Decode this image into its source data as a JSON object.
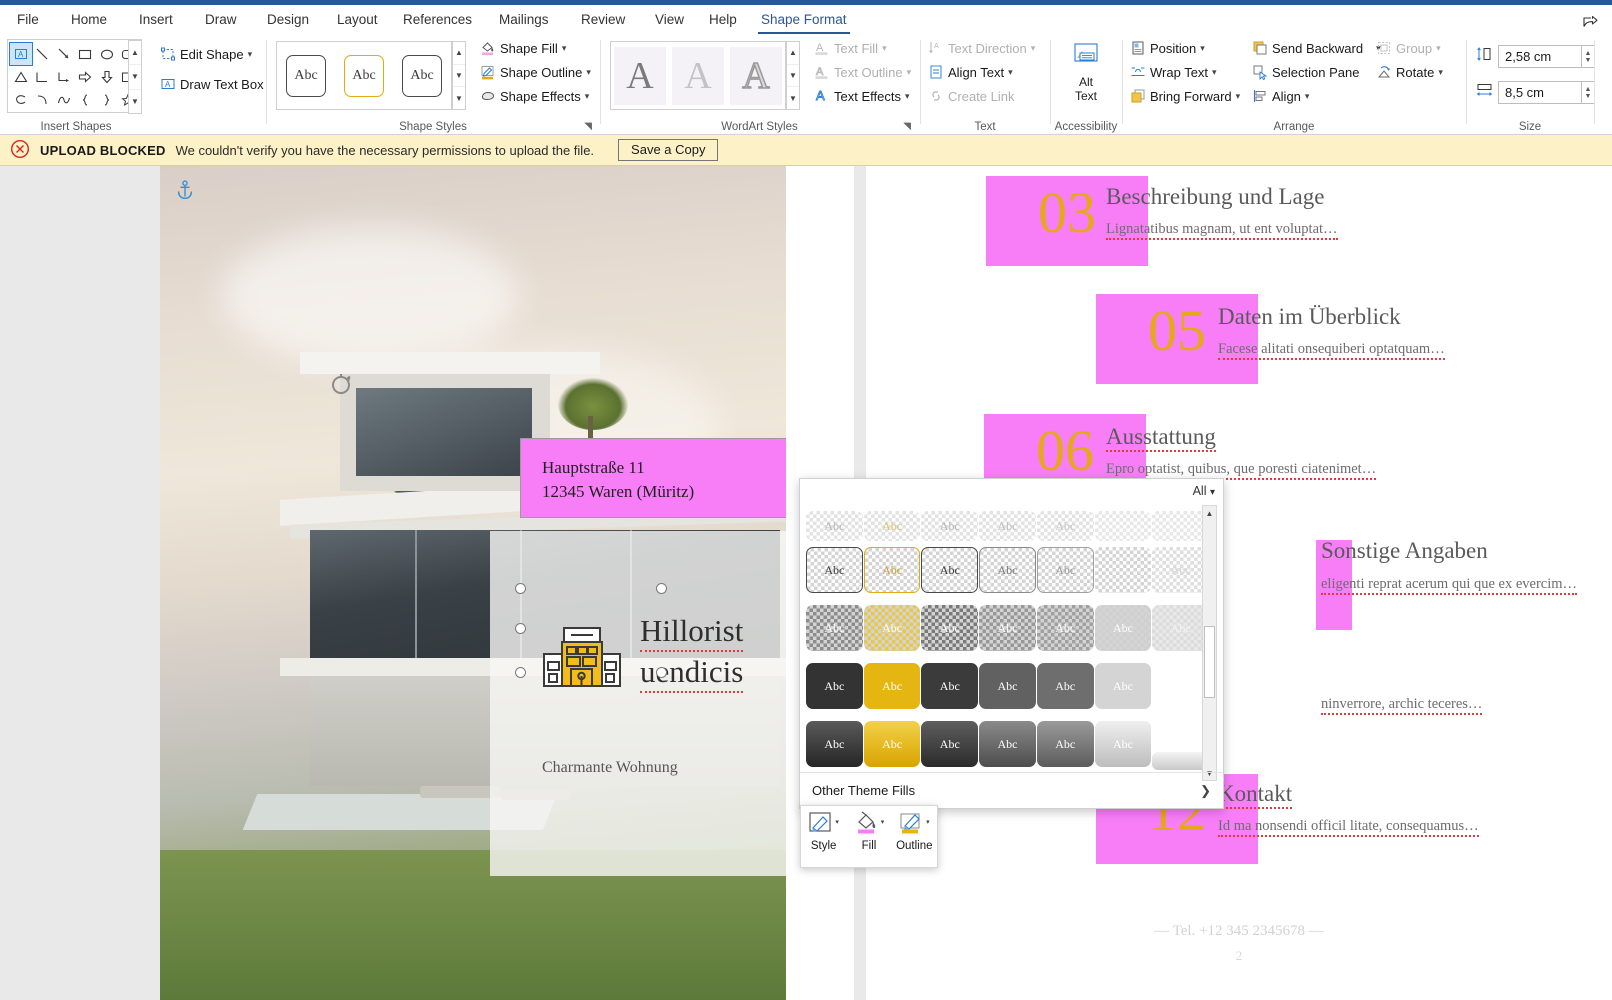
{
  "app": {
    "accent_blue": "#2b579a",
    "share_icon": "share-icon"
  },
  "tabs": [
    {
      "label": "File",
      "active": false
    },
    {
      "label": "Home",
      "active": false
    },
    {
      "label": "Insert",
      "active": false
    },
    {
      "label": "Draw",
      "active": false
    },
    {
      "label": "Design",
      "active": false
    },
    {
      "label": "Layout",
      "active": false
    },
    {
      "label": "References",
      "active": false
    },
    {
      "label": "Mailings",
      "active": false
    },
    {
      "label": "Review",
      "active": false
    },
    {
      "label": "View",
      "active": false
    },
    {
      "label": "Help",
      "active": false
    },
    {
      "label": "Shape Format",
      "active": true
    }
  ],
  "ribbon": {
    "groups": [
      {
        "name": "Insert Shapes",
        "label": "Insert Shapes"
      },
      {
        "name": "Shape Styles",
        "label": "Shape Styles"
      },
      {
        "name": "WordArt Styles",
        "label": "WordArt Styles"
      },
      {
        "name": "Text",
        "label": "Text"
      },
      {
        "name": "Accessibility",
        "label": "Accessibility"
      },
      {
        "name": "Arrange",
        "label": "Arrange"
      },
      {
        "name": "Size",
        "label": "Size"
      }
    ],
    "insert_shapes": {
      "edit_shape": "Edit Shape",
      "draw_text_box": "Draw Text Box"
    },
    "shape_styles": {
      "shape_fill": "Shape Fill",
      "shape_outline": "Shape Outline",
      "shape_effects": "Shape Effects",
      "preview_text": "Abc",
      "fill_color": "#f4a6e0",
      "outline_color": "#e0ac16"
    },
    "wordart": {
      "text_fill": "Text Fill",
      "text_outline": "Text Outline",
      "text_effects": "Text Effects",
      "preview_glyph": "A"
    },
    "text": {
      "text_direction": "Text Direction",
      "align_text": "Align Text",
      "create_link": "Create Link"
    },
    "accessibility": {
      "alt_text_line1": "Alt",
      "alt_text_line2": "Text"
    },
    "arrange": {
      "position": "Position",
      "wrap_text": "Wrap Text",
      "bring_forward": "Bring Forward",
      "send_backward": "Send Backward",
      "selection_pane": "Selection Pane",
      "align": "Align",
      "group": "Group",
      "rotate": "Rotate"
    },
    "size": {
      "height_value": "2,58 cm",
      "width_value": "8,5 cm"
    }
  },
  "notification": {
    "title": "UPLOAD BLOCKED",
    "message": "We couldn't verify you have the necessary permissions to upload the file.",
    "button": "Save a Copy",
    "bg_color": "#fdf2c7"
  },
  "document": {
    "anchor_icon": "anchor-icon",
    "card": {
      "name_line1": "Hillorist",
      "name_line2": "uendicis",
      "subtitle": "Charmante Wohnung",
      "logo_icon": "building-icon",
      "rotate_icon": "rotate-handle-icon"
    },
    "selected_textbox": {
      "line1": "Hauptstraße 11",
      "line2": "12345 Waren (Müritz)",
      "fill_color": "#f87ef8"
    },
    "toc_entries": [
      {
        "number": "03",
        "heading": "Beschreibung und Lage",
        "subtext": "Lignatatibus magnam, ut ent voluptat…"
      },
      {
        "number": "05",
        "heading": "Daten im Überblick",
        "subtext": "Facese alitati onsequiberi optatquam…"
      },
      {
        "number": "06",
        "heading": "Ausstattung",
        "subtext": "Epro optatist, quibus, que poresti ciatenimet…"
      },
      {
        "number": "",
        "heading": "Sonstige Angaben",
        "subtext": "eligenti reprat acerum qui que ex evercim…"
      },
      {
        "number": "",
        "heading": "",
        "subtext": "ninverrore, archic teceres…"
      },
      {
        "number": "12",
        "heading": "Kontakt",
        "subtext": "Id ma nonsendi officil litate, consequamus…"
      }
    ],
    "footer_phone": "— Tel. +12 345 2345678 —",
    "page_number": "2",
    "accent_pink": "#f87ef8",
    "accent_gold": "#e5a81a"
  },
  "fill_gallery": {
    "filter_label": "All",
    "swatch_text": "Abc",
    "other_theme_fills": "Other Theme Fills",
    "rows": [
      [
        {
          "style": "checker",
          "text": "Abc",
          "textcolor": "#888",
          "border": "none",
          "faded": true
        },
        {
          "style": "checker",
          "text": "Abc",
          "textcolor": "#c9a227",
          "border": "none",
          "faded": true
        },
        {
          "style": "checker",
          "text": "Abc",
          "textcolor": "#888",
          "border": "none",
          "faded": true
        },
        {
          "style": "checker",
          "text": "Abc",
          "textcolor": "#999",
          "border": "none",
          "faded": true
        },
        {
          "style": "checker",
          "text": "Abc",
          "textcolor": "#999",
          "border": "none",
          "faded": true
        },
        {
          "style": "checker",
          "text": "",
          "textcolor": "#999",
          "border": "none",
          "faded": true
        },
        {
          "style": "checker",
          "text": "",
          "textcolor": "#999",
          "border": "none",
          "faded": true
        }
      ],
      [
        {
          "style": "checker",
          "text": "Abc",
          "textcolor": "#3a3a3a",
          "border": "#4a4a4a"
        },
        {
          "style": "checker",
          "text": "Abc",
          "textcolor": "#c9a227",
          "border": "#e0ac16"
        },
        {
          "style": "checker",
          "text": "Abc",
          "textcolor": "#3a3a3a",
          "border": "#4a4a4a"
        },
        {
          "style": "checker",
          "text": "Abc",
          "textcolor": "#6e6e6e",
          "border": "#7d7d7d"
        },
        {
          "style": "checker",
          "text": "Abc",
          "textcolor": "#8a8a8a",
          "border": "#969696"
        },
        {
          "style": "checker",
          "text": "",
          "textcolor": "#aaa",
          "border": "none"
        },
        {
          "style": "checker",
          "text": "Abc",
          "textcolor": "#c8c8c8",
          "border": "none"
        }
      ],
      [
        {
          "style": "solid",
          "fill": "#8c8c8c",
          "text": "Abc",
          "textcolor": "#fff",
          "checker": true
        },
        {
          "style": "solid",
          "fill": "#e8c84a",
          "text": "Abc",
          "textcolor": "#fff",
          "checker": true
        },
        {
          "style": "solid",
          "fill": "#7a7a7a",
          "text": "Abc",
          "textcolor": "#fff",
          "checker": true
        },
        {
          "style": "solid",
          "fill": "#989898",
          "text": "Abc",
          "textcolor": "#fff",
          "checker": true
        },
        {
          "style": "solid",
          "fill": "#a0a0a0",
          "text": "Abc",
          "textcolor": "#fff",
          "checker": true
        },
        {
          "style": "solid",
          "fill": "#cfcfcf",
          "text": "Abc",
          "textcolor": "#fff",
          "checker": true
        },
        {
          "style": "solid",
          "fill": "#e2e2e2",
          "text": "Abc",
          "textcolor": "#efefef",
          "checker": true
        }
      ],
      [
        {
          "style": "solid",
          "fill": "#333333",
          "text": "Abc",
          "textcolor": "#ffffff"
        },
        {
          "style": "solid",
          "fill": "#e5b611",
          "text": "Abc",
          "textcolor": "#ffffff"
        },
        {
          "style": "solid",
          "fill": "#3b3b3b",
          "text": "Abc",
          "textcolor": "#ffffff"
        },
        {
          "style": "solid",
          "fill": "#616161",
          "text": "Abc",
          "textcolor": "#ffffff"
        },
        {
          "style": "solid",
          "fill": "#6e6e6e",
          "text": "Abc",
          "textcolor": "#ffffff"
        },
        {
          "style": "solid",
          "fill": "#d4d4d4",
          "text": "Abc",
          "textcolor": "#ffffff"
        },
        {
          "style": "none",
          "fill": "transparent",
          "text": "",
          "textcolor": "#fff"
        }
      ],
      [
        {
          "style": "grad",
          "fill": "linear-gradient(180deg,#5a5a5a,#262626)",
          "text": "Abc",
          "textcolor": "#ffffff"
        },
        {
          "style": "grad",
          "fill": "linear-gradient(180deg,#f2d24a,#d9a400)",
          "text": "Abc",
          "textcolor": "#ffffff"
        },
        {
          "style": "grad",
          "fill": "linear-gradient(180deg,#5e5e5e,#2b2b2b)",
          "text": "Abc",
          "textcolor": "#ffffff"
        },
        {
          "style": "grad",
          "fill": "linear-gradient(180deg,#8a8a8a,#4d4d4d)",
          "text": "Abc",
          "textcolor": "#ffffff"
        },
        {
          "style": "grad",
          "fill": "linear-gradient(180deg,#9a9a9a,#5c5c5c)",
          "text": "Abc",
          "textcolor": "#ffffff"
        },
        {
          "style": "grad",
          "fill": "linear-gradient(180deg,#efefef,#bdbdbd)",
          "text": "Abc",
          "textcolor": "#ffffff"
        },
        {
          "style": "pill",
          "fill": "linear-gradient(180deg,#f4f4f4,#c9c9c9)",
          "text": "",
          "textcolor": "#fff"
        }
      ]
    ]
  },
  "mini_toolbar": {
    "items": [
      {
        "label": "Style",
        "icon": "shape-style-icon"
      },
      {
        "label": "Fill",
        "icon": "fill-bucket-icon",
        "swatch": "#f87ef8"
      },
      {
        "label": "Outline",
        "icon": "outline-pen-icon",
        "swatch": "#e5b611"
      }
    ]
  }
}
